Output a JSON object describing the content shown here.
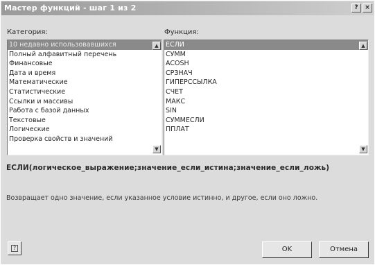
{
  "window": {
    "title": "Мастер функций - шаг 1 из 2",
    "help_btn_glyph": "?",
    "close_btn_glyph": "×"
  },
  "category": {
    "label": "Категория:",
    "items": [
      "10 недавно использовавшихся",
      "Полный алфавитный перечень",
      "Финансовые",
      "Дата и время",
      "Математические",
      "Статистические",
      "Ссылки и массивы",
      "Работа с базой данных",
      "Текстовые",
      "Логические",
      "Проверка свойств и значений"
    ],
    "selected_index": 0
  },
  "function": {
    "label": "Функция:",
    "items": [
      "ЕСЛИ",
      "СУММ",
      "ACOSH",
      "СРЗНАЧ",
      "ГИПЕРССЫЛКА",
      "СЧЕТ",
      "МАКС",
      "SIN",
      "СУММЕСЛИ",
      "ППЛАТ"
    ],
    "selected_index": 0
  },
  "syntax": "ЕСЛИ(логическое_выражение;значение_если_истина;значение_если_ложь)",
  "description": "Возвращает одно значение, если указанное условие истинно, и другое, если оно ложно.",
  "buttons": {
    "ok": "OK",
    "cancel": "Отмена"
  },
  "scroll_glyphs": {
    "up": "▲",
    "down": "▼"
  },
  "icons": {
    "office_assistant": "?"
  }
}
